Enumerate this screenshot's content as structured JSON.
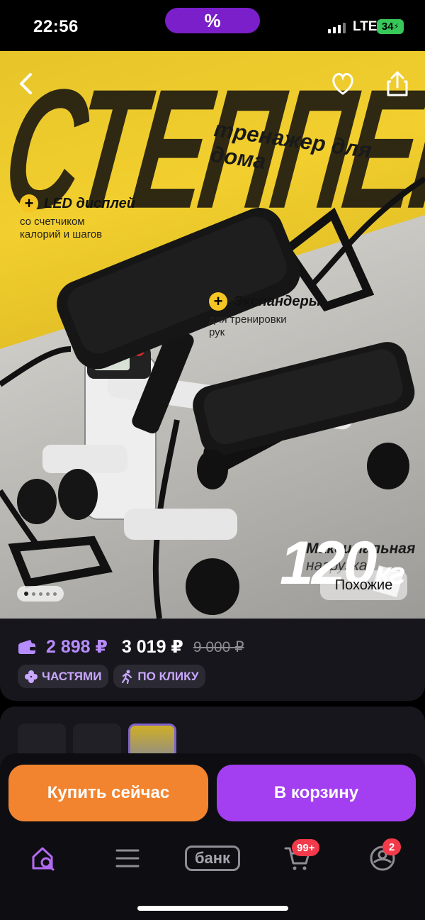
{
  "status_bar": {
    "time": "22:56",
    "pill_symbol": "%",
    "network": "LTE",
    "battery": "34"
  },
  "hero": {
    "headline": "СТЕППЕР",
    "subtitle": "тренажер для дома",
    "features": [
      {
        "title": "LED дисплей",
        "desc": "со счетчиком калорий и шагов"
      },
      {
        "title": "Экспандеры",
        "desc": "для тренировки рук"
      }
    ],
    "load_label_1": "Максимальная",
    "load_label_2": "нагрузка",
    "weight_value": "120",
    "weight_unit": "кг",
    "similar_label": "Похожие",
    "slides_total": 5,
    "slide_active": 1
  },
  "price": {
    "wallet_price": "2 898 ₽",
    "price": "3 019 ₽",
    "old_price": "9 000 ₽",
    "badges": [
      "ЧАСТЯМИ",
      "ПО КЛИКУ"
    ]
  },
  "actions": {
    "buy_now": "Купить сейчас",
    "add_to_cart": "В корзину"
  },
  "tab_bar": {
    "bank_label": "банк",
    "cart_count": "99+",
    "profile_count": "2"
  },
  "colors": {
    "accent_purple": "#a33ff0",
    "accent_orange": "#f2842f",
    "price_purple": "#b78cff",
    "badge_red": "#f23a4b"
  }
}
